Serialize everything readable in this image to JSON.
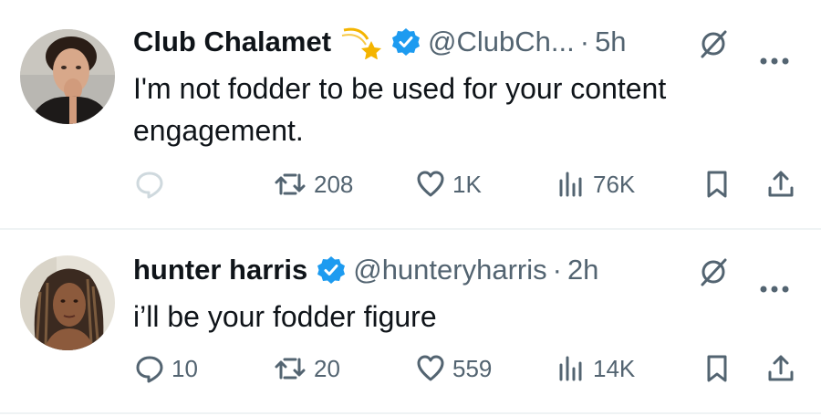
{
  "tweets": [
    {
      "name": "Club Chalamet",
      "has_emoji_badge": true,
      "handle": "@ClubCh...",
      "separator": "·",
      "time": "5h",
      "text": "I'm not fodder to be used for your content engagement.",
      "replies": "",
      "retweets": "208",
      "likes": "1K",
      "views": "76K"
    },
    {
      "name": "hunter harris",
      "has_emoji_badge": false,
      "handle": "@hunteryharris",
      "separator": "·",
      "time": "2h",
      "text": "i’ll be your fodder figure",
      "replies": "10",
      "retweets": "20",
      "likes": "559",
      "views": "14K"
    }
  ],
  "colors": {
    "text": "#0f1419",
    "secondary": "#536471",
    "verified": "#1d9bf0",
    "divider": "#eff3f4",
    "reply_faded": "#cfd9de"
  },
  "icons": {
    "reply": "reply-icon",
    "retweet": "retweet-icon",
    "like": "heart-icon",
    "views": "views-icon",
    "bookmark": "bookmark-icon",
    "share": "share-icon",
    "grok": "grok-icon",
    "more": "more-icon",
    "verified": "verified-badge-icon",
    "emoji": "dizzy-star-emoji-icon"
  }
}
